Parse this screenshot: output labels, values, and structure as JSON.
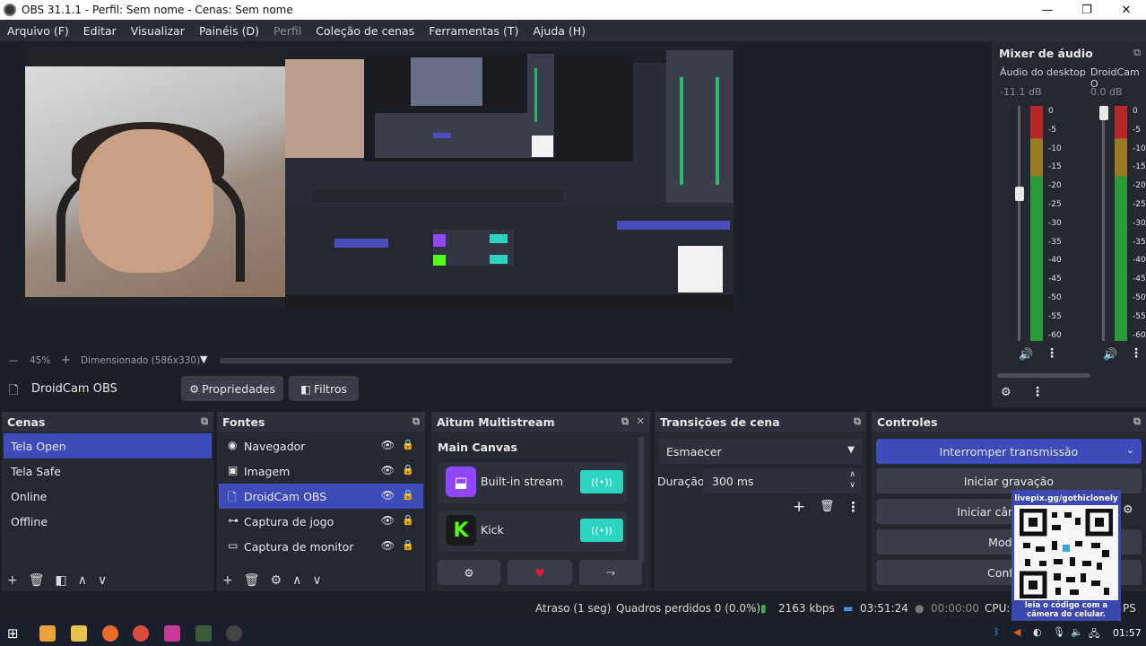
{
  "window": {
    "title": "OBS 31.1.1 - Perfil: Sem nome - Cenas: Sem nome",
    "minimize": "—",
    "maximize": "❐",
    "close": "✕"
  },
  "menu": [
    "Arquivo (F)",
    "Editar",
    "Visualizar",
    "Painéis (D)",
    "Perfil",
    "Coleção de cenas",
    "Ferramentas (T)",
    "Ajuda (H)"
  ],
  "zoom": {
    "minus": "—",
    "value": "45%",
    "plus": "+",
    "mode": "Dimensionado (586x330)"
  },
  "source_bar": {
    "selected": "DroidCam OBS",
    "properties": "Propriedades",
    "filters": "Filtros"
  },
  "mixer": {
    "title": "Mixer de áudio",
    "channels": [
      {
        "name": "Áudio do desktop",
        "db": "-11.1 dB",
        "level": 0.25
      },
      {
        "name": "DroidCam O",
        "db": "0.0 dB",
        "level": 0.0
      }
    ],
    "scale": [
      "0",
      "-5",
      "-10",
      "-15",
      "-20",
      "-25",
      "-30",
      "-35",
      "-40",
      "-45",
      "-50",
      "-55",
      "-60"
    ]
  },
  "scenes": {
    "title": "Cenas",
    "items": [
      "Tela Open",
      "Tela Safe",
      "Online",
      "Offline"
    ],
    "selected": 0
  },
  "sources": {
    "title": "Fontes",
    "items": [
      {
        "name": "Navegador",
        "icon": "globe-icon"
      },
      {
        "name": "Imagem",
        "icon": "image-icon"
      },
      {
        "name": "DroidCam OBS",
        "icon": "file-icon"
      },
      {
        "name": "Captura de jogo",
        "icon": "gamepad-icon"
      },
      {
        "name": "Captura de monitor",
        "icon": "monitor-icon"
      }
    ],
    "selected": 2
  },
  "multistream": {
    "title": "Aitum Multistream",
    "canvas": "Main Canvas",
    "targets": [
      "Built-in stream",
      "Kick"
    ],
    "brand_colors": {
      "twitch": "#9146ff",
      "kick": "#53fc18",
      "teal": "#2dd4bf"
    }
  },
  "transitions": {
    "title": "Transições de cena",
    "selected": "Esmaecer",
    "duration_label": "Duração",
    "duration": "300 ms"
  },
  "controls": {
    "title": "Controles",
    "buttons": [
      "Interromper transmissão",
      "Iniciar gravação",
      "Iniciar câmera",
      "Modo e",
      "Configu"
    ]
  },
  "status": {
    "delay": "Atraso (1 seg)",
    "dropped": "Quadros perdidos 0 (0.0%)",
    "bitrate": "2163 kbps",
    "stream_time": "03:51:24",
    "rec_time": "00:00:00",
    "cpu": "CPU:",
    "fps": "PS"
  },
  "qr": {
    "top": "livepix.gg/gothiclonely",
    "bottom": "leia o código com a câmera do celular."
  },
  "taskbar": {
    "time": "01:57"
  }
}
